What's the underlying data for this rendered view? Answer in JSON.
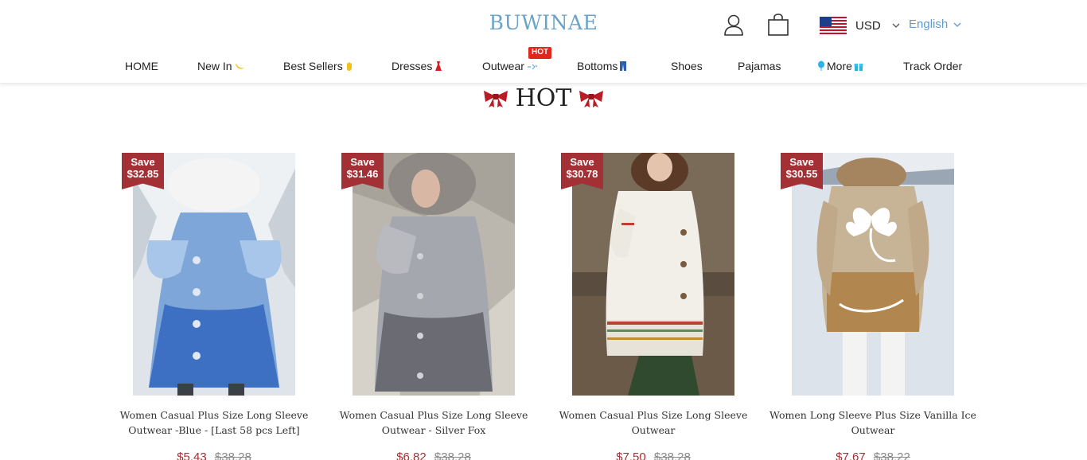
{
  "header": {
    "logo": "BUWINAE",
    "currency": "USD",
    "language": "English"
  },
  "nav": {
    "items": [
      {
        "label": "HOME"
      },
      {
        "label": "New In"
      },
      {
        "label": "Best Sellers"
      },
      {
        "label": "Dresses"
      },
      {
        "label": "Outwear",
        "badge": "HOT"
      },
      {
        "label": "Bottoms"
      },
      {
        "label": "Shoes"
      },
      {
        "label": "Pajamas"
      },
      {
        "label": "More"
      },
      {
        "label": "Track Order"
      }
    ]
  },
  "section": {
    "title": "HOT"
  },
  "products": [
    {
      "save_label": "Save",
      "save_amount": "$32.85",
      "title": "Women Casual Plus Size Long Sleeve Outwear -Blue - [Last 58 pcs Left]",
      "price": "$5.43",
      "old_price": "$38.28"
    },
    {
      "save_label": "Save",
      "save_amount": "$31.46",
      "title": "Women Casual Plus Size Long Sleeve Outwear - Silver Fox",
      "price": "$6.82",
      "old_price": "$38.28"
    },
    {
      "save_label": "Save",
      "save_amount": "$30.78",
      "title": "Women Casual Plus Size Long Sleeve Outwear",
      "price": "$7.50",
      "old_price": "$38.28"
    },
    {
      "save_label": "Save",
      "save_amount": "$30.55",
      "title": "Women Long Sleeve Plus Size Vanilla Ice Outwear",
      "price": "$7.67",
      "old_price": "$38.22"
    }
  ],
  "icons": {
    "user": "user-icon",
    "cart": "shopping-bag-icon",
    "flag": "us-flag-icon",
    "bow": "red-bow-icon"
  },
  "colors": {
    "logo": "#6aa3c9",
    "language": "#5b9bd6",
    "sale_red": "#a33035",
    "hot_badge": "#e0261d"
  }
}
